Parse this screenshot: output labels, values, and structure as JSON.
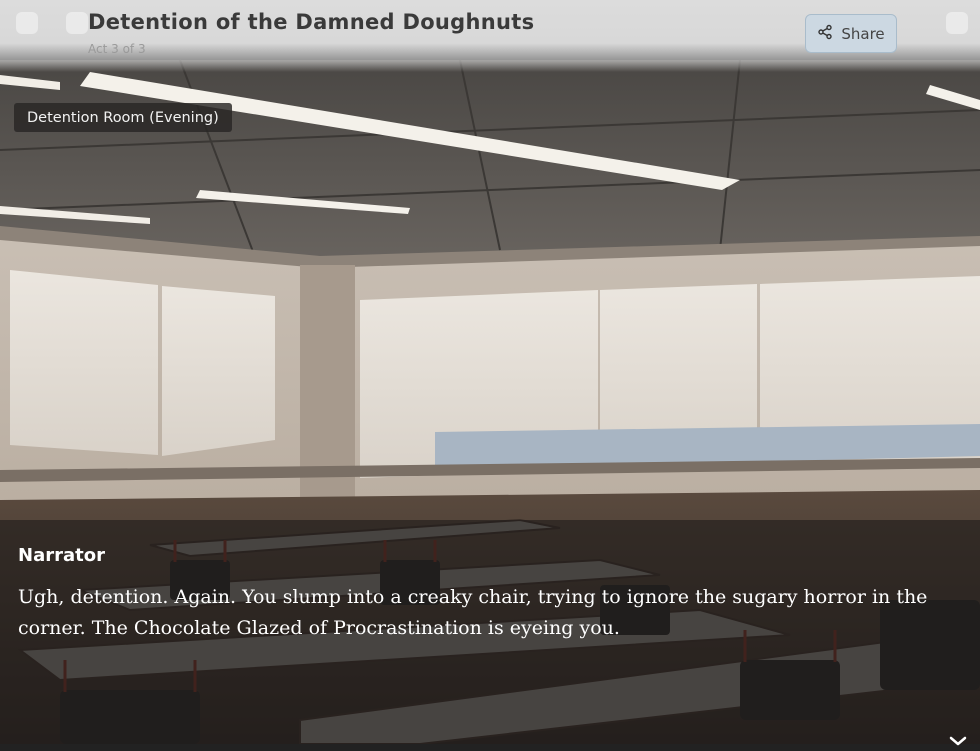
{
  "header": {
    "title": "Detention of the Damned Doughnuts",
    "subtitle": "Act 3 of 3",
    "share_label": "Share"
  },
  "scene": {
    "location": "Detention Room (Evening)"
  },
  "dialogue": {
    "speaker": "Narrator",
    "text": "Ugh, detention. Again. You slump into a creaky chair, trying to ignore the sugary horror in the corner. The Chocolate Glazed of Procrastination is eyeing you."
  },
  "icons": {
    "share": "share-icon",
    "advance": "chevron-down-icon"
  }
}
